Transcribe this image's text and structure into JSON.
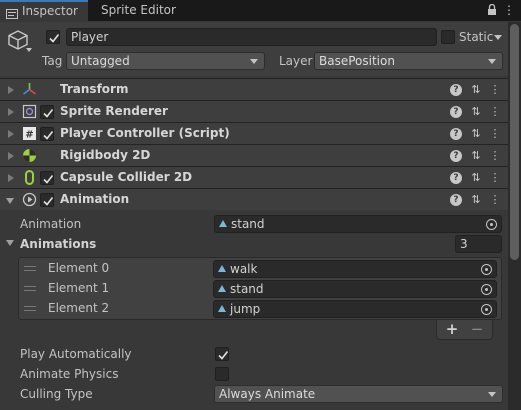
{
  "tabs": [
    {
      "label": "Inspector",
      "active": true
    },
    {
      "label": "Sprite Editor",
      "active": false
    }
  ],
  "object": {
    "name": "Player",
    "active": true,
    "static_label": "Static",
    "tag_label": "Tag",
    "tag_value": "Untagged",
    "layer_label": "Layer",
    "layer_value": "BasePosition"
  },
  "components": [
    {
      "name": "Transform",
      "icon": "transform-icon",
      "checkbox": false
    },
    {
      "name": "Sprite Renderer",
      "icon": "sprite-renderer-icon",
      "checkbox": true
    },
    {
      "name": "Player Controller (Script)",
      "icon": "script-icon",
      "checkbox": true
    },
    {
      "name": "Rigidbody 2D",
      "icon": "rigidbody-icon",
      "checkbox": false
    },
    {
      "name": "Capsule Collider 2D",
      "icon": "capsule-collider-icon",
      "checkbox": true
    },
    {
      "name": "Animation",
      "icon": "animation-icon",
      "checkbox": true,
      "expanded": true
    }
  ],
  "animation": {
    "animation_label": "Animation",
    "animation_value": "stand",
    "animations_label": "Animations",
    "animations_count": "3",
    "elements": [
      {
        "label": "Element 0",
        "value": "walk"
      },
      {
        "label": "Element 1",
        "value": "stand"
      },
      {
        "label": "Element 2",
        "value": "jump"
      }
    ],
    "add_symbol": "+",
    "remove_symbol": "−",
    "play_automatically_label": "Play Automatically",
    "play_automatically": true,
    "animate_physics_label": "Animate Physics",
    "animate_physics": false,
    "culling_type_label": "Culling Type",
    "culling_type_value": "Always Animate"
  },
  "colors": {
    "accent": "#3a79bb",
    "panel": "#383838",
    "header": "#3e3e3e"
  }
}
